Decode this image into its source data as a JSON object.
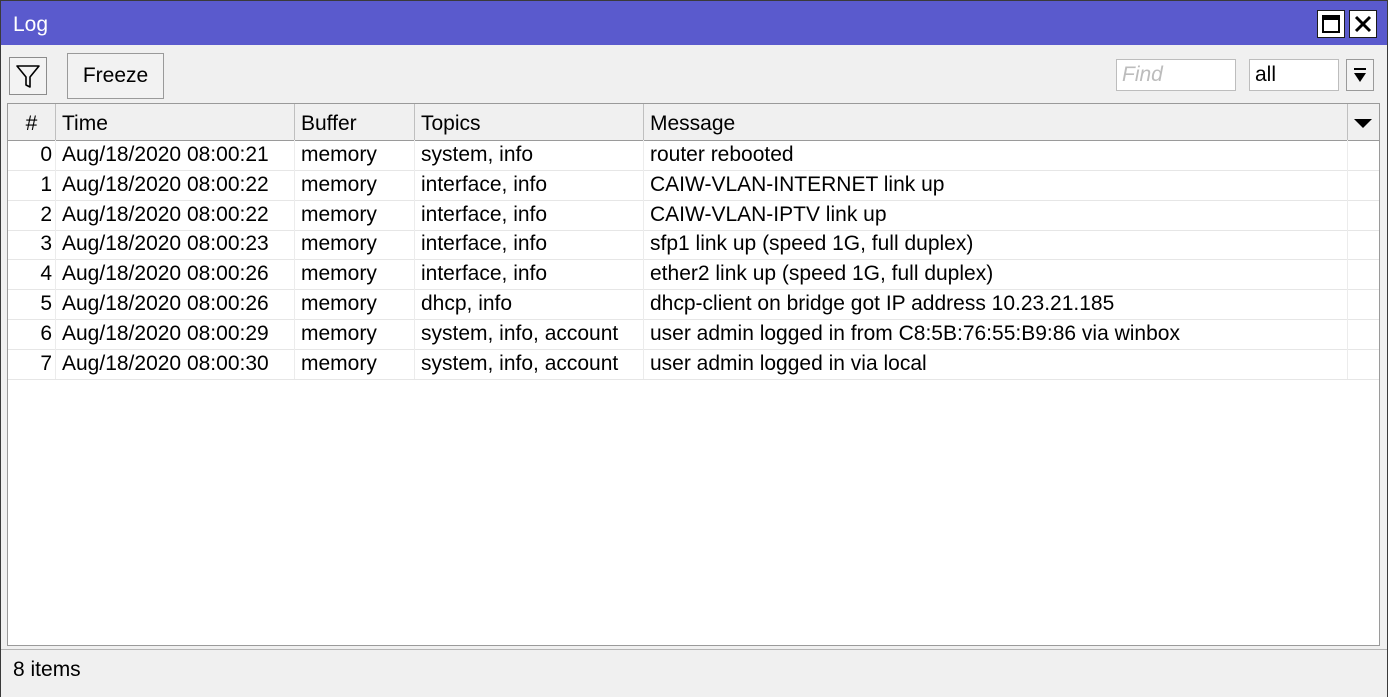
{
  "window": {
    "title": "Log"
  },
  "toolbar": {
    "freeze_label": "Freeze",
    "find_placeholder": "Find",
    "topic_filter_value": "all"
  },
  "table": {
    "columns": [
      "#",
      "Time",
      "Buffer",
      "Topics",
      "Message"
    ],
    "rows": [
      {
        "num": "0",
        "time": "Aug/18/2020 08:00:21",
        "buffer": "memory",
        "topics": "system, info",
        "message": "router rebooted"
      },
      {
        "num": "1",
        "time": "Aug/18/2020 08:00:22",
        "buffer": "memory",
        "topics": "interface, info",
        "message": "CAIW-VLAN-INTERNET link up"
      },
      {
        "num": "2",
        "time": "Aug/18/2020 08:00:22",
        "buffer": "memory",
        "topics": "interface, info",
        "message": "CAIW-VLAN-IPTV link up"
      },
      {
        "num": "3",
        "time": "Aug/18/2020 08:00:23",
        "buffer": "memory",
        "topics": "interface, info",
        "message": "sfp1 link up (speed 1G, full duplex)"
      },
      {
        "num": "4",
        "time": "Aug/18/2020 08:00:26",
        "buffer": "memory",
        "topics": "interface, info",
        "message": "ether2 link up (speed 1G, full duplex)"
      },
      {
        "num": "5",
        "time": "Aug/18/2020 08:00:26",
        "buffer": "memory",
        "topics": "dhcp, info",
        "message": "dhcp-client on bridge got IP address 10.23.21.185"
      },
      {
        "num": "6",
        "time": "Aug/18/2020 08:00:29",
        "buffer": "memory",
        "topics": "system, info, account",
        "message": "user admin logged in from C8:5B:76:55:B9:86 via winbox"
      },
      {
        "num": "7",
        "time": "Aug/18/2020 08:00:30",
        "buffer": "memory",
        "topics": "system, info, account",
        "message": "user admin logged in via local"
      }
    ]
  },
  "status": {
    "text": "8 items"
  },
  "colors": {
    "titlebar": "#5a5acd",
    "chrome": "#f0f0f0",
    "border": "#9a9a9a"
  },
  "icons": {
    "maximize": "maximize-icon",
    "close": "close-icon",
    "filter": "filter-icon",
    "dropdown": "dropdown-arrow-icon",
    "column_menu": "chevron-down-icon"
  }
}
